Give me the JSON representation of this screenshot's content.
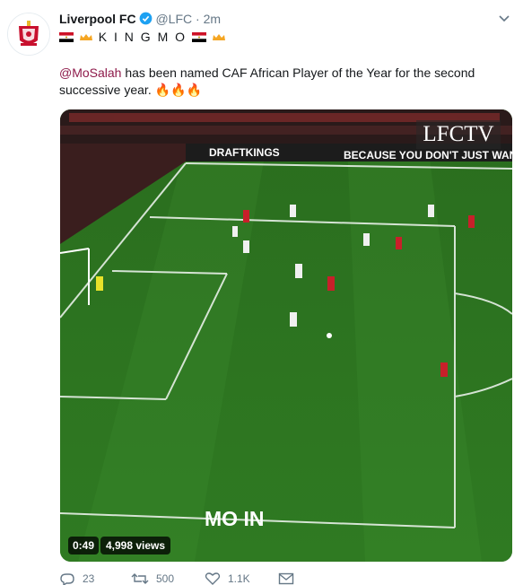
{
  "account": {
    "name": "Liverpool FC",
    "handle": "@LFC",
    "separator": "·",
    "time": "2m",
    "bio_text": "K I N G M O",
    "avatar": "liverpool-crest-logo"
  },
  "tweet": {
    "mention": "@MoSalah",
    "text": " has been named CAF African Player of the Year for the second successive year. ",
    "emoji": "🔥🔥🔥"
  },
  "media": {
    "channel_logo": "LFCTV",
    "caption": "MO IN",
    "board_left": "DRAFTKINGS",
    "board_right": "BECAUSE YOU DON'T JUST WAN",
    "duration": "0:49",
    "views": "4,998 views"
  },
  "actions": {
    "reply_count": "23",
    "retweet_count": "500",
    "like_count": "1.1K"
  },
  "colors": {
    "accent": "#8e1a4a",
    "verified": "#1da1f2",
    "pitch": "#2f7a22",
    "fire": "#f5a623"
  }
}
